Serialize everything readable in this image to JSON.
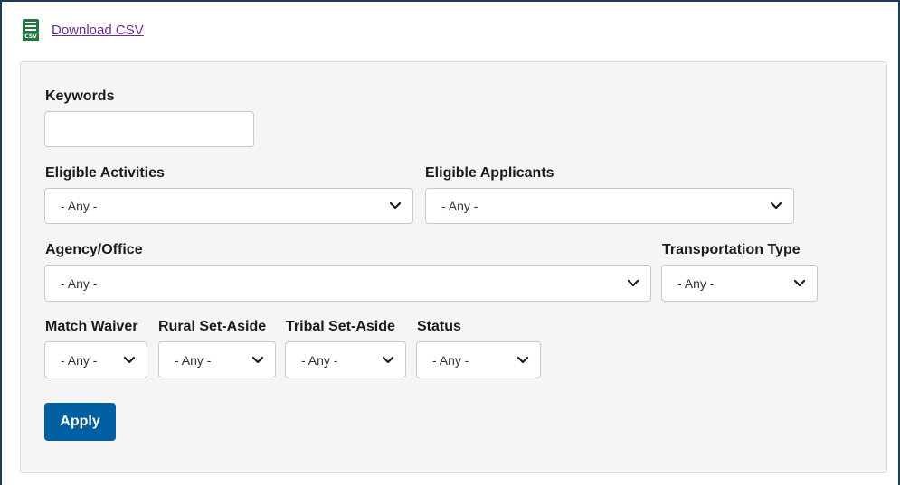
{
  "download": {
    "icon": "csv-file-icon",
    "icon_tag": "CSV",
    "label": "Download CSV",
    "link_color": "#6b2c91"
  },
  "filters": {
    "keywords": {
      "label": "Keywords",
      "value": ""
    },
    "eligible_activities": {
      "label": "Eligible Activities",
      "value": "- Any -"
    },
    "eligible_applicants": {
      "label": "Eligible Applicants",
      "value": "- Any -"
    },
    "agency_office": {
      "label": "Agency/Office",
      "value": "- Any -"
    },
    "transportation_type": {
      "label": "Transportation Type",
      "value": "- Any -"
    },
    "match_waiver": {
      "label": "Match Waiver",
      "value": "- Any -"
    },
    "rural_set_aside": {
      "label": "Rural Set-Aside",
      "value": "- Any -"
    },
    "tribal_set_aside": {
      "label": "Tribal Set-Aside",
      "value": "- Any -"
    },
    "status": {
      "label": "Status",
      "value": "- Any -"
    }
  },
  "apply_button": {
    "label": "Apply",
    "color": "#005ea2"
  }
}
